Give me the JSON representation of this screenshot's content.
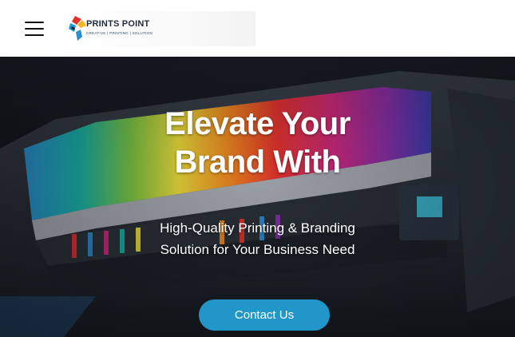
{
  "header": {
    "menu_icon": "hamburger-menu-icon",
    "logo": {
      "name": "PRINTS POINT",
      "tagline": "CREATIVE | PRINTING | SOLUTION"
    }
  },
  "hero": {
    "title_line1": "Elevate Your",
    "title_line2": "Brand With",
    "subtitle_line1": "High-Quality Printing & Branding",
    "subtitle_line2": "Solution for Your Business Need",
    "cta_label": "Contact Us"
  },
  "colors": {
    "cta": "#2196c9",
    "header_bg": "#ffffff",
    "text": "#ffffff"
  }
}
